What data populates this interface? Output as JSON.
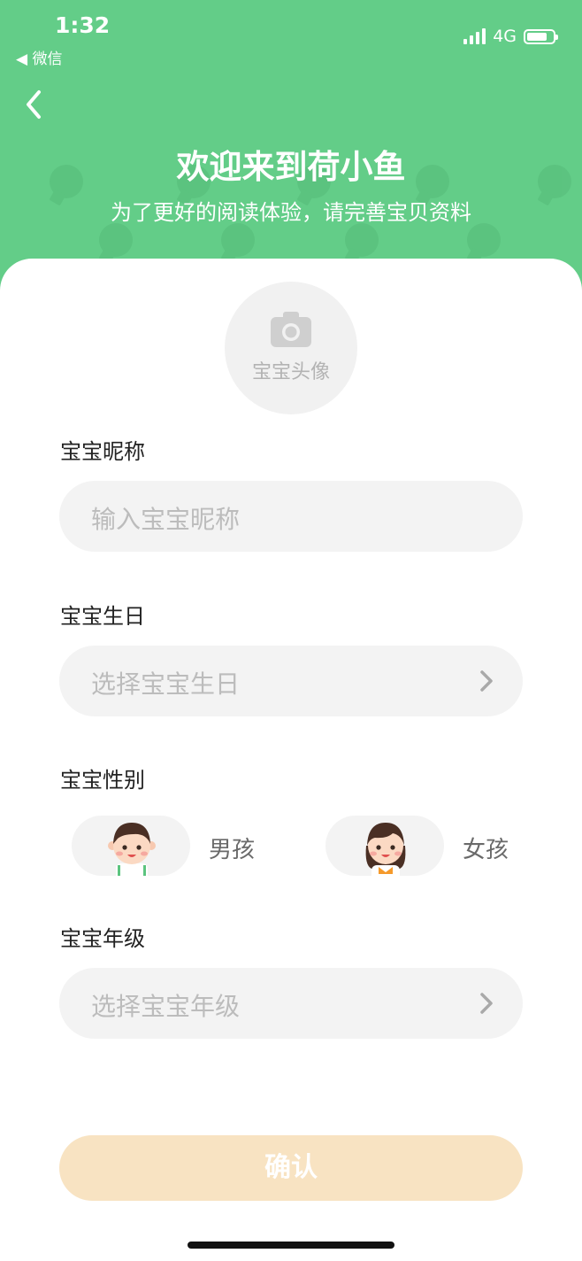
{
  "status_bar": {
    "time": "1:32",
    "back_app": "◀ 微信",
    "network": "4G",
    "battery_level": 0.8
  },
  "header": {
    "title": "欢迎来到荷小鱼",
    "subtitle": "为了更好的阅读体验，请完善宝贝资料"
  },
  "avatar": {
    "label": "宝宝头像"
  },
  "nickname": {
    "label": "宝宝昵称",
    "placeholder": "输入宝宝昵称"
  },
  "birthday": {
    "label": "宝宝生日",
    "placeholder": "选择宝宝生日"
  },
  "gender": {
    "label": "宝宝性别",
    "boy": "男孩",
    "girl": "女孩"
  },
  "grade": {
    "label": "宝宝年级",
    "placeholder": "选择宝宝年级"
  },
  "confirm_button": "确认",
  "colors": {
    "header_green": "#63cd88",
    "input_bg": "#f3f3f3",
    "confirm_bg": "#f8e3c2",
    "placeholder": "#bcbcbc"
  }
}
